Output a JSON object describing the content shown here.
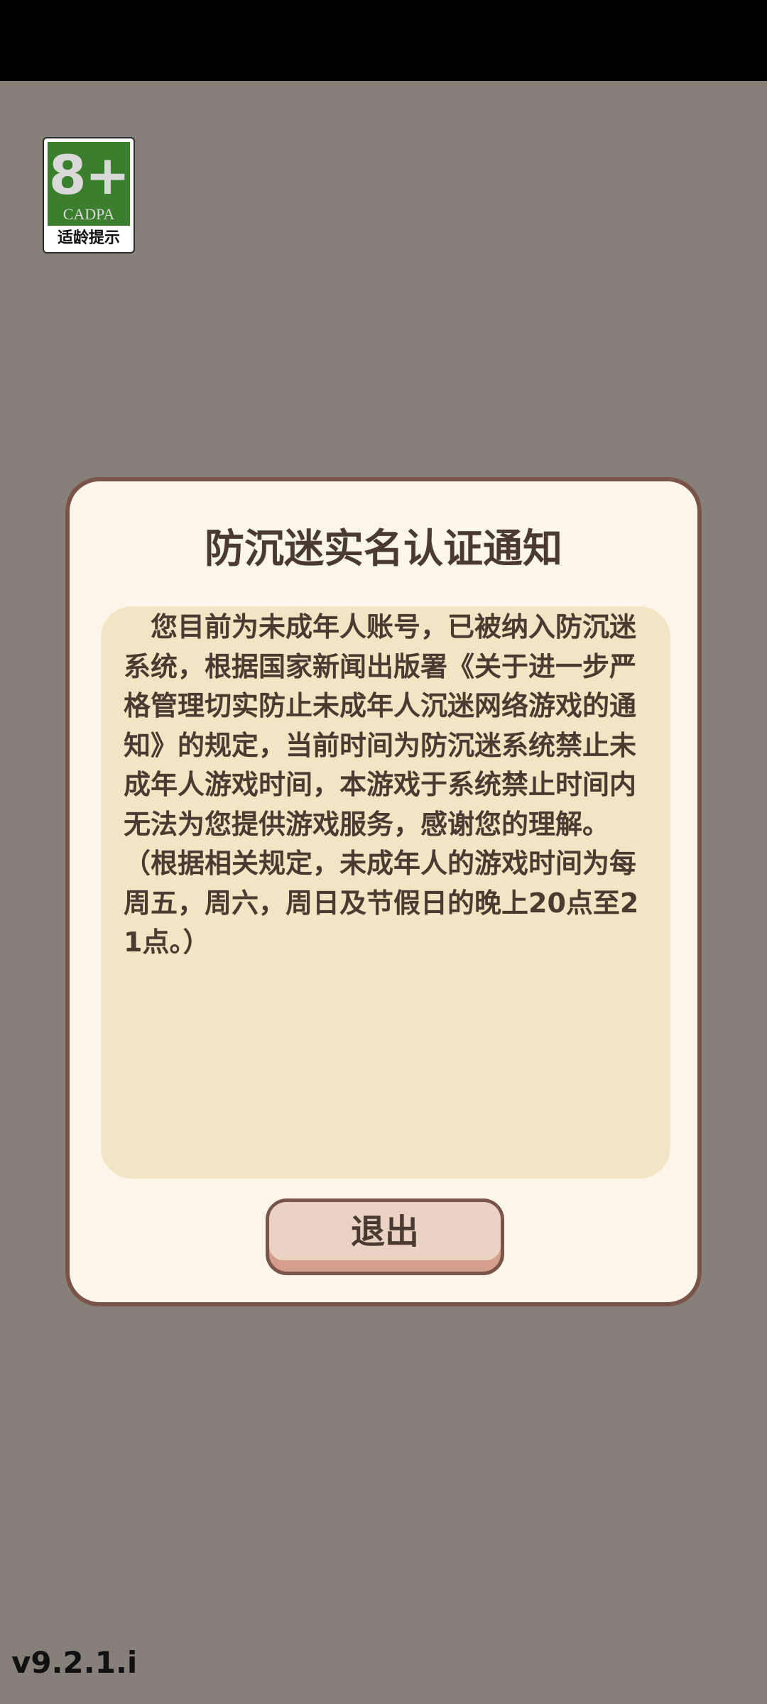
{
  "age_badge": {
    "rating": "8+",
    "org": "CADPA",
    "caption": "适龄提示",
    "color": "#3b7e2e"
  },
  "dialog": {
    "title": "防沉迷实名认证通知",
    "body": "您目前为未成年人账号，已被纳入防沉迷系统，根据国家新闻出版署《关于进一步严格管理切实防止未成年人沉迷网络游戏的通知》的规定，当前时间为防沉迷系统禁止未成年人游戏时间，本游戏于系统禁止时间内无法为您提供游戏服务，感谢您的理解。（根据相关规定，未成年人的游戏时间为每周五，周六，周日及节假日的晚上20点至21点。）",
    "exit_label": "退出"
  },
  "version": "v9.2.1.i",
  "colors": {
    "background": "#868079",
    "dialog_bg": "#fcf5ea",
    "dialog_border": "#7a5448",
    "panel_bg": "#f3e4c3",
    "button_face": "#ead3c2",
    "button_shadow": "#d59e8a",
    "text": "#4a3a32"
  }
}
